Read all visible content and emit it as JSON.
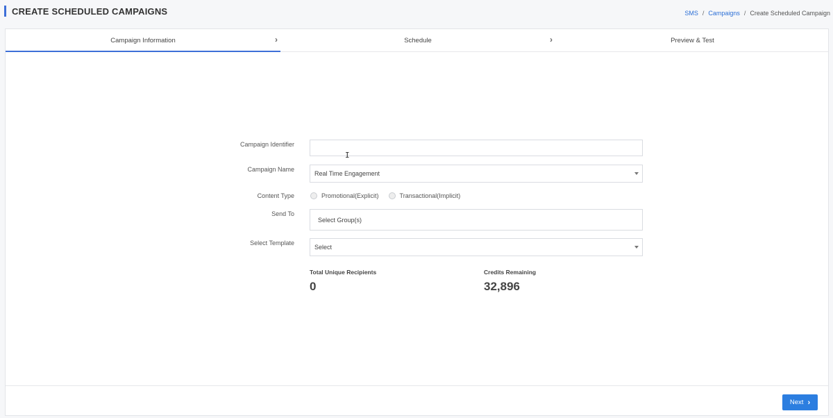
{
  "header": {
    "title": "CREATE SCHEDULED CAMPAIGNS",
    "breadcrumb": [
      "SMS",
      "Campaigns",
      "Create Scheduled Campaign"
    ]
  },
  "steps": [
    {
      "label": "Campaign  Information",
      "active": true
    },
    {
      "label": "Schedule",
      "active": false
    },
    {
      "label": "Preview  & Test",
      "active": false
    }
  ],
  "form": {
    "identifier_label": "Campaign Identifier",
    "identifier_value": "",
    "name_label": "Campaign Name",
    "name_value": "Real Time Engagement",
    "content_type_label": "Content Type",
    "content_type_options": [
      "Promotional(Explicit)",
      "Transactional(Implicit)"
    ],
    "send_to_label": "Send To",
    "send_to_placeholder": "Select Group(s)",
    "template_label": "Select Template",
    "template_value": "Select"
  },
  "stats": {
    "recipients_label": "Total Unique Recipients",
    "recipients_value": "0",
    "credits_label": "Credits Remaining",
    "credits_value": "32,896"
  },
  "footer": {
    "next_label": "Next"
  },
  "colors": {
    "accent": "#3d6fd8",
    "button": "#2c7ee0",
    "link": "#2c6fd6"
  }
}
